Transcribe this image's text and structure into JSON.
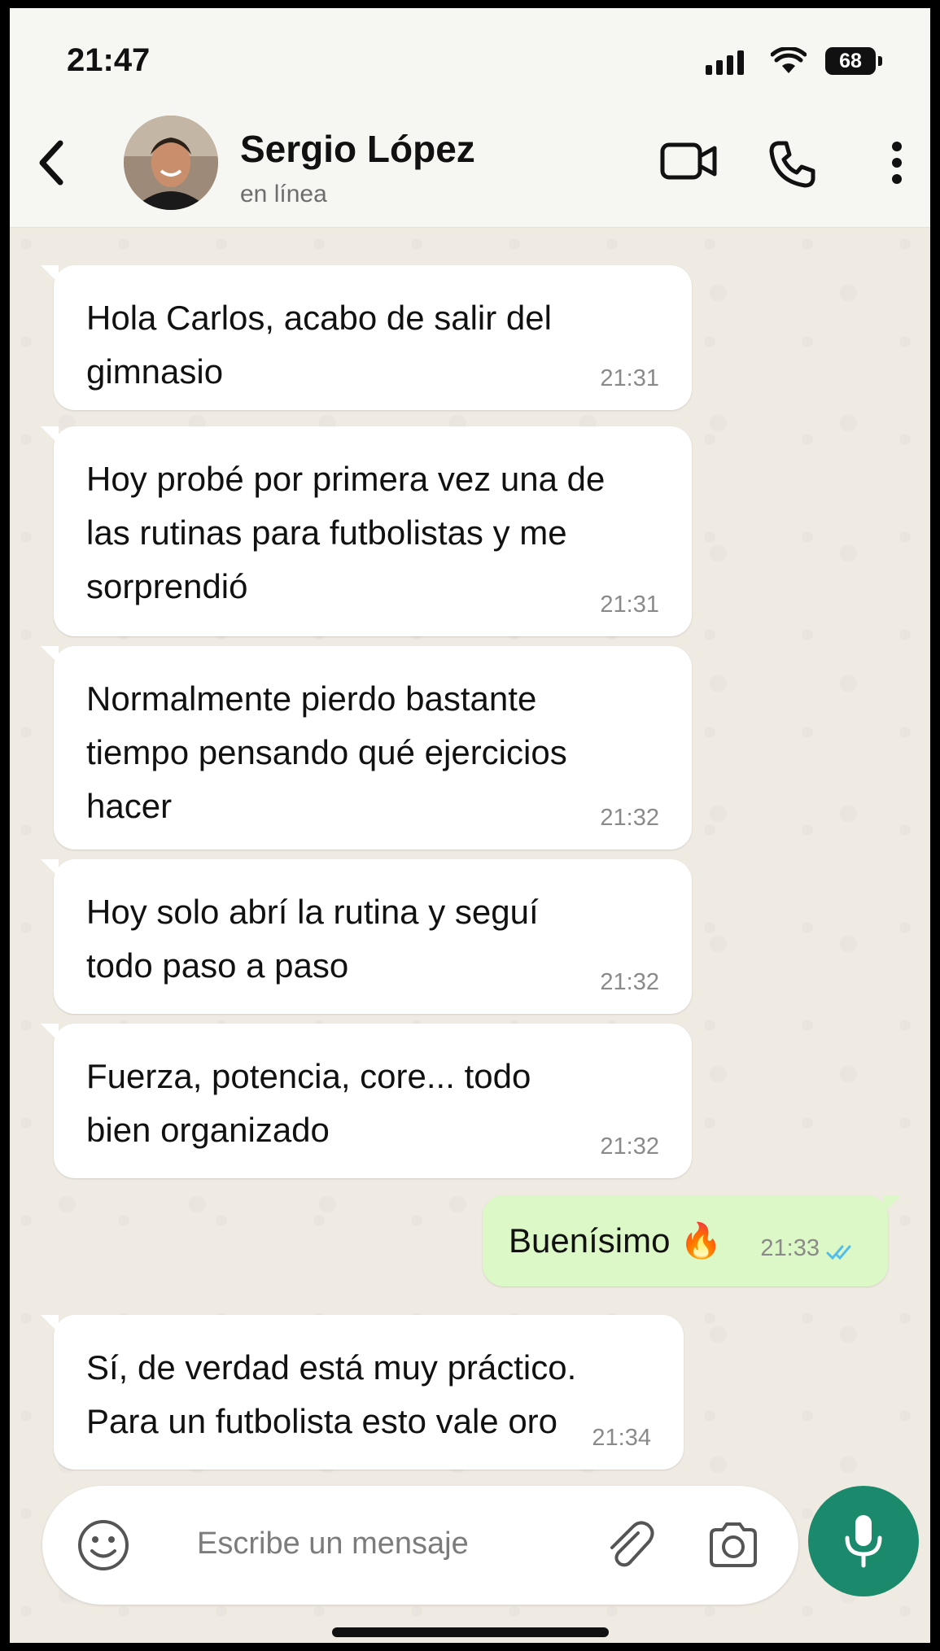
{
  "status_bar": {
    "time": "21:47",
    "battery": "68"
  },
  "header": {
    "contact_name": "Sergio López",
    "contact_status": "en línea",
    "icons": [
      "back-arrow-icon",
      "video-call-icon",
      "phone-icon",
      "more-options-icon"
    ]
  },
  "messages": [
    {
      "direction": "in",
      "text": "Hola Carlos, acabo de salir del\ngimnasio",
      "time": "21:31"
    },
    {
      "direction": "in",
      "text": "Hoy probé por primera vez una de\nlas rutinas para futbolistas y me\nsorprendió",
      "time": "21:31"
    },
    {
      "direction": "in",
      "text": "Normalmente pierdo bastante\ntiempo pensando qué ejercicios\nhacer",
      "time": "21:32"
    },
    {
      "direction": "in",
      "text": "Hoy solo abrí la rutina y seguí\ntodo paso a paso",
      "time": "21:32"
    },
    {
      "direction": "in",
      "text": "Fuerza, potencia, core... todo\nbien organizado",
      "time": "21:32"
    },
    {
      "direction": "out",
      "text": "Buenísimo 🔥",
      "time": "21:33",
      "read": true
    },
    {
      "direction": "in",
      "text": "Sí, de verdad está muy práctico.\nPara un futbolista esto vale oro",
      "time": "21:34"
    }
  ],
  "composer": {
    "placeholder": "Escribe un mensaje",
    "icons": [
      "emoji-icon",
      "attach-icon",
      "camera-icon",
      "microphone-icon"
    ]
  },
  "colors": {
    "accent": "#1b8a6c",
    "outgoing_bubble": "#dcf8c6",
    "incoming_bubble": "#ffffff",
    "read_ticks": "#53bdeb"
  }
}
